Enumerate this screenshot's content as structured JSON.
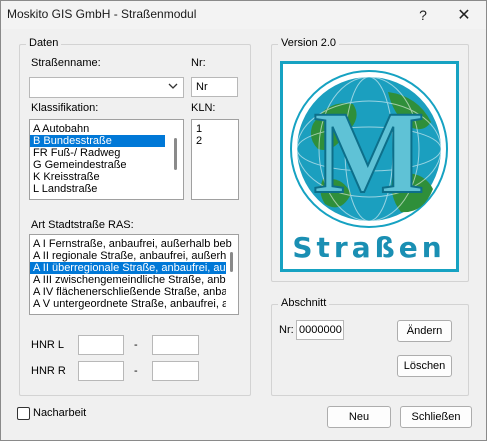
{
  "window": {
    "title": "Moskito GIS GmbH - Straßenmodul",
    "help_glyph": "?",
    "close_glyph": "✕"
  },
  "daten": {
    "group_label": "Daten",
    "strassenname_label": "Straßenname:",
    "strassenname_value": "",
    "nr_label": "Nr:",
    "nr_value": "Nr",
    "klassifikation_label": "Klassifikation:",
    "klassifikation_items": [
      "A Autobahn",
      "B Bundesstraße",
      "FR Fuß-/ Radweg",
      "G Gemeindestraße",
      "K Kreisstraße",
      "L Landstraße"
    ],
    "klassifikation_selected": 1,
    "kln_label": "KLN:",
    "kln_items": [
      "1",
      "2"
    ],
    "ras_label": "Art Stadtstraße RAS:",
    "ras_items": [
      "A I Fernstraße, anbaufrei, außerhalb beb",
      "A II regionale Straße, anbaufrei, außerhal",
      "A II überregionale Straße, anbaufrei, auß",
      "A III zwischengemeindliche Straße, anbau",
      "A IV flächenerschließende Straße, anba",
      "A V untergeordnete Straße, anbaufrei, a"
    ],
    "ras_selected": 2,
    "hnr_l_label": "HNR L",
    "hnr_r_label": "HNR R",
    "dash": "-",
    "hnr_l_from": "",
    "hnr_l_to": "",
    "hnr_r_from": "",
    "hnr_r_to": ""
  },
  "version": {
    "group_label": "Version 2.0",
    "logo_letter": "M",
    "logo_text": "Straßen"
  },
  "abschnitt": {
    "group_label": "Abschnitt",
    "nr_label": "Nr:",
    "nr_value": "0000000",
    "aendern_label": "Ändern",
    "loeschen_label": "Löschen"
  },
  "footer": {
    "nacharbeit_label": "Nacharbeit",
    "nacharbeit_checked": false,
    "neu_label": "Neu",
    "schliessen_label": "Schließen"
  },
  "colors": {
    "selection": "#0078d7",
    "logo_teal": "#1b9fbf",
    "logo_green": "#2f8f3a",
    "logo_text": "#1a8fb3"
  },
  "icons": {
    "help": "help-icon",
    "close": "close-icon",
    "dropdown": "chevron-down-icon"
  }
}
